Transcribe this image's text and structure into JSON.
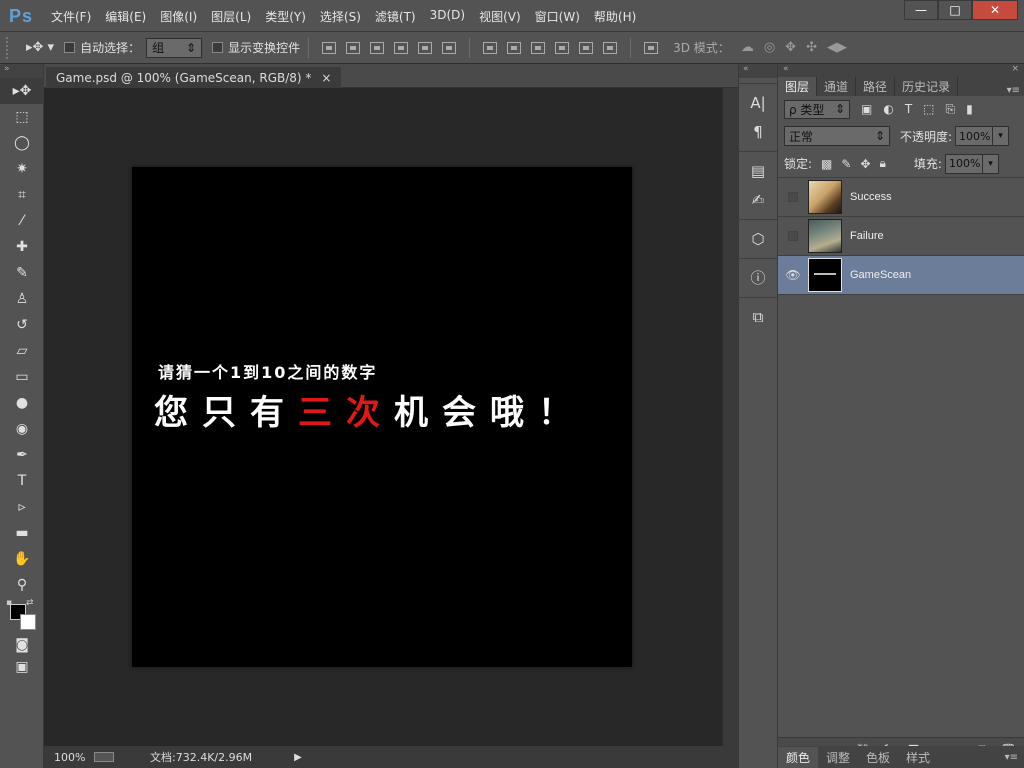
{
  "app": {
    "logo": "Ps"
  },
  "menu": [
    "文件(F)",
    "编辑(E)",
    "图像(I)",
    "图层(L)",
    "类型(Y)",
    "选择(S)",
    "滤镜(T)",
    "3D(D)",
    "视图(V)",
    "窗口(W)",
    "帮助(H)"
  ],
  "window_controls": {
    "minimize": "—",
    "restore": "□",
    "close": "✕"
  },
  "options": {
    "auto_select_label": "自动选择：",
    "auto_select_value": "组",
    "show_transform_label": "显示变换控件",
    "mode3d_label": "3D 模式："
  },
  "document": {
    "tab_title": "Game.psd @ 100% (GameScean, RGB/8) *",
    "close": "×",
    "text_line1": "请猜一个1到10之间的数字",
    "text_line2_pre": "您只有",
    "text_line2_highlight": "三次",
    "text_line2_post": "机会哦！"
  },
  "status": {
    "zoom": "100%",
    "doc_size": "文档:732.4K/2.96M"
  },
  "layers_panel": {
    "tabs": [
      "图层",
      "通道",
      "路径",
      "历史记录"
    ],
    "filter_type": "ρ 类型",
    "blend_mode": "正常",
    "opacity_label": "不透明度:",
    "opacity_value": "100%",
    "lock_label": "锁定:",
    "fill_label": "填充:",
    "fill_value": "100%",
    "layers": [
      {
        "name": "Success",
        "visible": false,
        "selected": false
      },
      {
        "name": "Failure",
        "visible": false,
        "selected": false
      },
      {
        "name": "GameScean",
        "visible": true,
        "selected": true
      }
    ]
  },
  "bottom_tabs": [
    "颜色",
    "调整",
    "色板",
    "样式"
  ],
  "colors": {
    "accent": "#6c7d99",
    "highlight_text": "#e01818",
    "canvas": "#000000"
  }
}
